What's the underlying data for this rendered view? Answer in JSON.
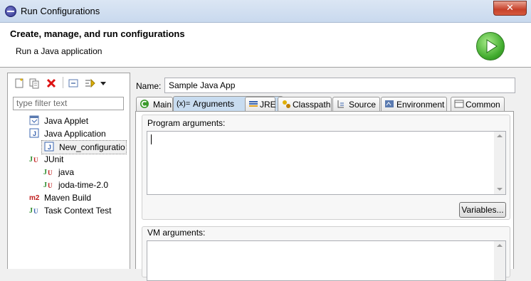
{
  "window": {
    "title": "Run Configurations",
    "close_glyph": "✕"
  },
  "banner": {
    "heading": "Create, manage, and run configurations",
    "subtitle": "Run a Java application"
  },
  "left_panel": {
    "filter_placeholder": "type filter text",
    "tree": [
      {
        "label": "Java Applet",
        "level": 1,
        "icon": "java-applet-icon"
      },
      {
        "label": "Java Application",
        "level": 1,
        "icon": "java-application-icon"
      },
      {
        "label": "New_configuratio",
        "level": 2,
        "icon": "java-application-icon",
        "selected": true
      },
      {
        "label": "JUnit",
        "level": 1,
        "icon": "junit-icon"
      },
      {
        "label": "java",
        "level": 2,
        "icon": "junit-icon"
      },
      {
        "label": "joda-time-2.0",
        "level": 2,
        "icon": "junit-icon"
      },
      {
        "label": "Maven Build",
        "level": 1,
        "icon": "maven-icon"
      },
      {
        "label": "Task Context Test",
        "level": 1,
        "icon": "task-context-icon"
      }
    ]
  },
  "main": {
    "name_label": "Name:",
    "name_value": "Sample Java App",
    "tabs": [
      {
        "label": "Main",
        "icon": "main-tab-icon"
      },
      {
        "label": "Arguments",
        "prefix": "(x)=",
        "icon": "arguments-tab-icon",
        "active": true
      },
      {
        "label": "JRE",
        "icon": "jre-tab-icon"
      },
      {
        "label": "Classpath",
        "icon": "classpath-tab-icon"
      },
      {
        "label": "Source",
        "icon": "source-tab-icon"
      },
      {
        "label": "Environment",
        "icon": "environment-tab-icon"
      },
      {
        "label": "Common",
        "icon": "common-tab-icon"
      }
    ],
    "program_args_label": "Program arguments:",
    "program_args_value": "",
    "variables_button": "Variables...",
    "vm_args_label": "VM arguments:"
  }
}
